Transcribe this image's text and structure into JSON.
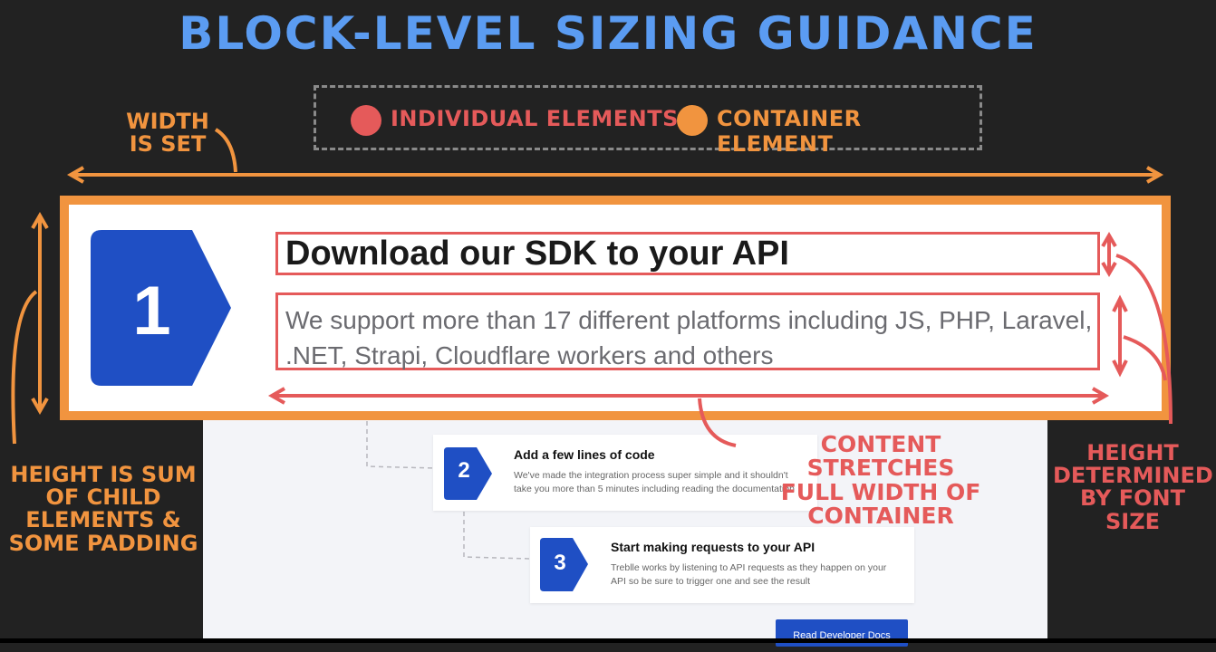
{
  "title": "BLOCK-LEVEL SIZING GUIDANCE",
  "legend": {
    "items": [
      {
        "label": "INDIVIDUAL ELEMENTS",
        "color": "#e55a5a"
      },
      {
        "label": "CONTAINER ELEMENT",
        "color": "#f1943f"
      }
    ]
  },
  "annotations": {
    "width_set": [
      "WIDTH",
      "IS SET"
    ],
    "height_sum": [
      "HEIGHT IS SUM",
      "OF CHILD",
      "ELEMENTS &",
      "SOME PADDING"
    ],
    "content_stretches": [
      "CONTENT STRETCHES",
      "FULL WIDTH OF",
      "CONTAINER"
    ],
    "height_font": [
      "HEIGHT",
      "DETERMINED",
      "BY FONT SIZE"
    ]
  },
  "steps": [
    {
      "number": "1",
      "title": "Download our SDK to your API",
      "description": "We support more than 17 different platforms including JS, PHP, Laravel, .NET, Strapi, Cloudflare workers and others"
    },
    {
      "number": "2",
      "title": "Add a few lines of code",
      "description": "We've made the integration process super simple and it shouldn't take you more than 5 minutes including reading the documentation"
    },
    {
      "number": "3",
      "title": "Start making requests to your API",
      "description": "Treblle works by listening to API requests as they happen on your API so be sure to trigger one and see the result"
    }
  ],
  "cta": {
    "label": "Read Developer Docs"
  },
  "colors": {
    "background": "#222222",
    "title": "#5b9cf2",
    "container": "#f1943f",
    "individual": "#e55a5a",
    "badge": "#1f4fc4"
  }
}
